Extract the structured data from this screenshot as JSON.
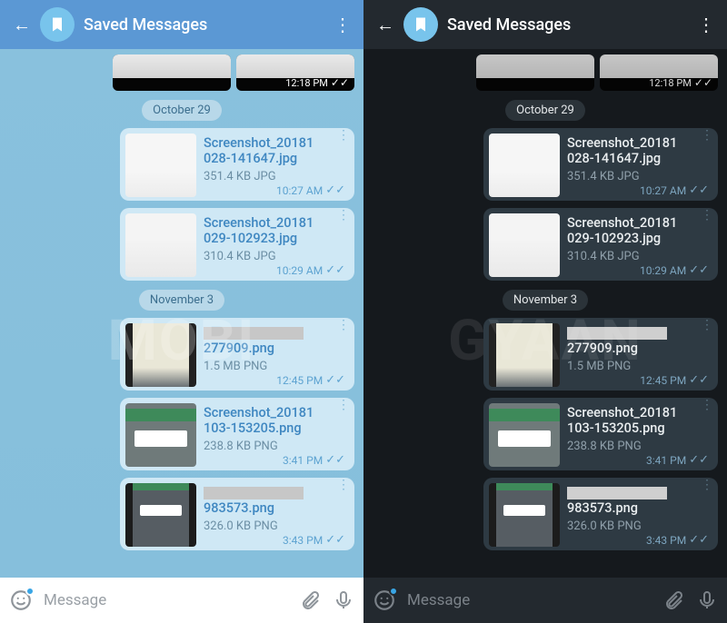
{
  "header": {
    "title": "Saved Messages"
  },
  "toprow_time": "12:18 PM",
  "dates": {
    "d1": "October 29",
    "d2": "November 3"
  },
  "msgs": {
    "m1": {
      "name1": "Screenshot_20181",
      "name2": "028-141647.jpg",
      "meta": "351.4 KB JPG",
      "time": "10:27 AM"
    },
    "m2": {
      "name1": "Screenshot_20181",
      "name2": "029-102923.jpg",
      "meta": "310.4 KB JPG",
      "time": "10:29 AM"
    },
    "m3": {
      "name_tail": "277909.png",
      "meta": "1.5 MB PNG",
      "time": "12:45 PM"
    },
    "m4": {
      "name1": "Screenshot_20181",
      "name2": "103-153205.png",
      "meta": "238.8 KB PNG",
      "time": "3:41 PM"
    },
    "m5": {
      "name_tail": "983573.png",
      "meta": "326.0 KB PNG",
      "time": "3:43 PM"
    }
  },
  "input": {
    "placeholder": "Message"
  },
  "watermark": {
    "left": "MOBI",
    "right": "GYAAN"
  }
}
